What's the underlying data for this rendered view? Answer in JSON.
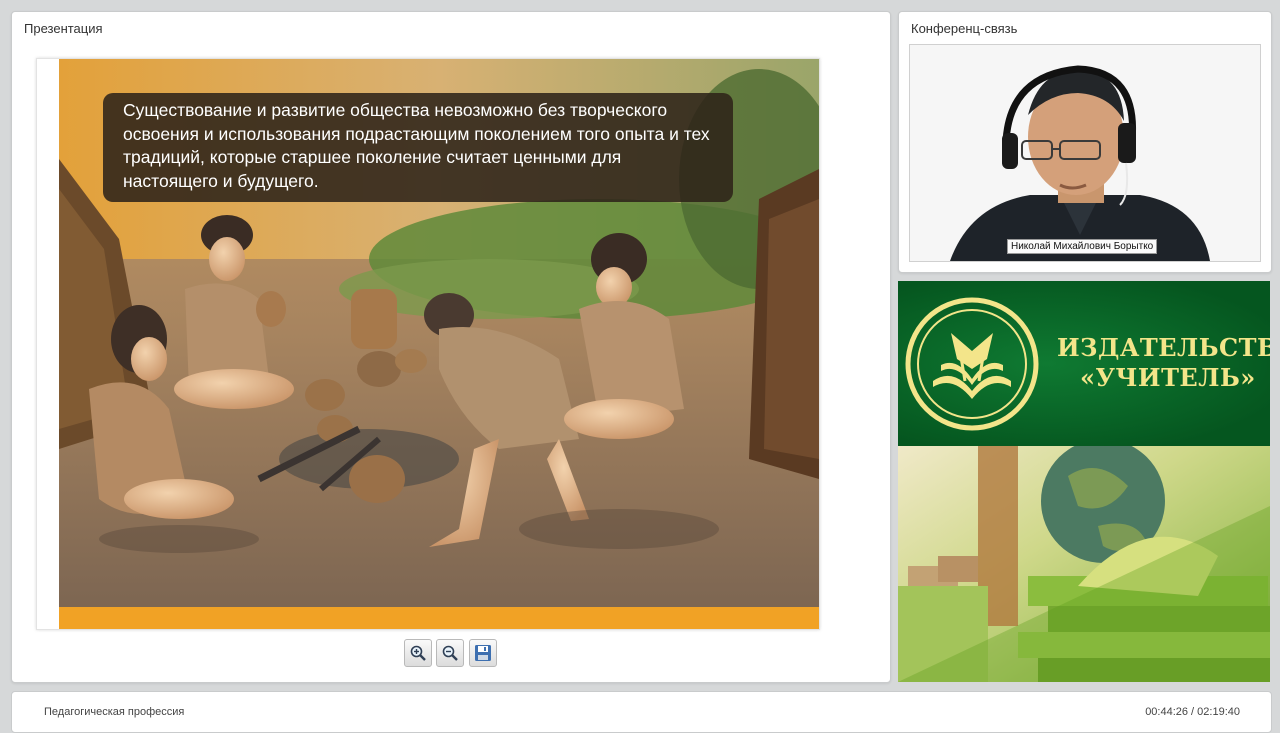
{
  "presentation": {
    "title": "Презентация",
    "slide_text": "Существование и развитие общества невозможно без творческого освоения и использования подрастающим поколением того опыта и тех традиций, которые старшее поколение считает ценными для настоящего и будущего.",
    "accent_color": "#f1a225",
    "toolbar": [
      {
        "name": "zoom-in-button",
        "icon": "zoom-in-icon"
      },
      {
        "name": "zoom-out-button",
        "icon": "zoom-out-icon"
      },
      {
        "name": "save-button",
        "icon": "save-icon"
      }
    ]
  },
  "conference": {
    "title": "Конференц-связь",
    "speaker_name": "Николай Михайлович Борытко"
  },
  "banner": {
    "line1": "ИЗДАТЕЛЬСТВО",
    "line2": "«УЧИТЕЛЬ»",
    "brand_color": "#05561f",
    "text_color": "#f3e58a"
  },
  "footer": {
    "course_title": "Педагогическая профессия",
    "time": "00:44:26 / 02:19:40"
  }
}
